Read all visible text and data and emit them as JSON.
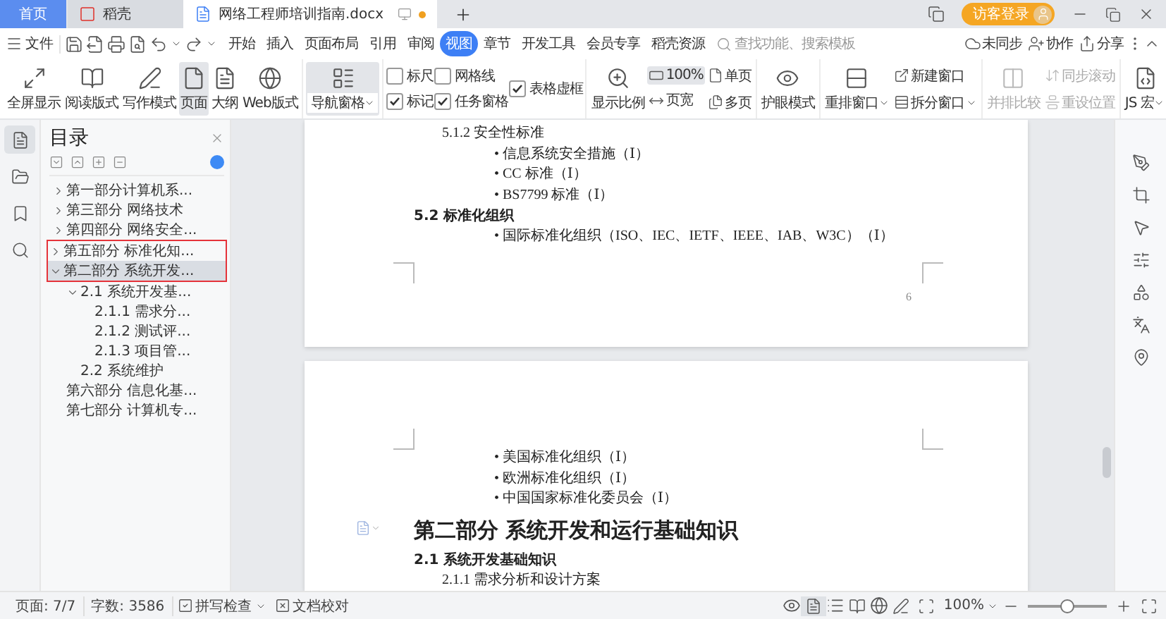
{
  "window": {
    "tabs": [
      {
        "label": "首页",
        "kind": "home",
        "selected": false,
        "modified": false
      },
      {
        "label": "稻壳",
        "kind": "app",
        "selected": false,
        "modified": false
      },
      {
        "label": "网络工程师培训指南.docx",
        "kind": "doc",
        "selected": true,
        "modified": true
      }
    ],
    "login_button": "访客登录"
  },
  "menu": {
    "file": "文件",
    "items": [
      {
        "label": "开始",
        "selected": false
      },
      {
        "label": "插入",
        "selected": false
      },
      {
        "label": "页面布局",
        "selected": false
      },
      {
        "label": "引用",
        "selected": false
      },
      {
        "label": "审阅",
        "selected": false
      },
      {
        "label": "视图",
        "selected": true
      },
      {
        "label": "章节",
        "selected": false
      },
      {
        "label": "开发工具",
        "selected": false
      },
      {
        "label": "会员专享",
        "selected": false
      },
      {
        "label": "稻壳资源",
        "selected": false
      }
    ],
    "search": {
      "placeholder": "查找功能、搜索模板"
    },
    "actions": [
      "未同步",
      "协作",
      "分享"
    ]
  },
  "ribbon": {
    "groups": [
      {
        "columns": [
          [
            {
              "kind": "large",
              "label": "全屏显示",
              "selected": false,
              "disabled": false,
              "dropdown": false
            }
          ],
          [
            {
              "kind": "large",
              "label": "阅读版式",
              "selected": false,
              "disabled": false,
              "dropdown": false
            }
          ],
          [
            {
              "kind": "large",
              "label": "写作模式",
              "selected": false,
              "disabled": false,
              "dropdown": false
            }
          ],
          [
            {
              "kind": "large",
              "label": "页面",
              "selected": true,
              "disabled": false,
              "dropdown": false
            }
          ],
          [
            {
              "kind": "large",
              "label": "大纲",
              "selected": false,
              "disabled": false,
              "dropdown": false
            }
          ],
          [
            {
              "kind": "large",
              "label": "Web版式",
              "selected": false,
              "disabled": false,
              "dropdown": false
            }
          ]
        ]
      },
      {
        "columns": [
          [
            {
              "kind": "large",
              "label": "导航窗格",
              "selected": true,
              "disabled": false,
              "dropdown": true
            }
          ]
        ]
      },
      {
        "columns": [
          [
            {
              "kind": "check",
              "label": "标尺",
              "checked": false
            },
            {
              "kind": "check",
              "label": "标记",
              "checked": true
            }
          ],
          [
            {
              "kind": "check",
              "label": "网格线",
              "checked": false
            },
            {
              "kind": "check",
              "label": "任务窗格",
              "checked": true
            }
          ],
          [
            {
              "kind": "check",
              "label": "表格虚框",
              "checked": true
            }
          ]
        ]
      },
      {
        "columns": [
          [
            {
              "kind": "large",
              "label": "显示比例",
              "selected": false,
              "disabled": false,
              "dropdown": false
            }
          ],
          [
            {
              "kind": "small",
              "label": "100%",
              "selected": true,
              "disabled": false,
              "dropdown": false
            },
            {
              "kind": "small",
              "label": "页宽",
              "selected": false,
              "disabled": false,
              "dropdown": false
            }
          ],
          [
            {
              "kind": "small",
              "label": "单页",
              "selected": false,
              "disabled": false,
              "dropdown": false
            },
            {
              "kind": "small",
              "label": "多页",
              "selected": false,
              "disabled": false,
              "dropdown": false
            }
          ]
        ]
      },
      {
        "columns": [
          [
            {
              "kind": "large",
              "label": "护眼模式",
              "selected": false,
              "disabled": false,
              "dropdown": false
            }
          ]
        ]
      },
      {
        "columns": [
          [
            {
              "kind": "large",
              "label": "重排窗口",
              "selected": false,
              "disabled": false,
              "dropdown": true
            }
          ],
          [
            {
              "kind": "small",
              "label": "新建窗口",
              "selected": false,
              "disabled": false,
              "dropdown": false
            },
            {
              "kind": "small",
              "label": "拆分窗口",
              "selected": false,
              "disabled": false,
              "dropdown": true
            }
          ]
        ]
      },
      {
        "columns": [
          [
            {
              "kind": "large",
              "label": "并排比较",
              "selected": false,
              "disabled": true,
              "dropdown": false
            }
          ],
          [
            {
              "kind": "small",
              "label": "同步滚动",
              "selected": false,
              "disabled": true,
              "dropdown": false
            },
            {
              "kind": "small",
              "label": "重设位置",
              "selected": false,
              "disabled": true,
              "dropdown": false
            }
          ]
        ]
      },
      {
        "columns": [
          [
            {
              "kind": "large",
              "label": "JS 宏",
              "selected": false,
              "disabled": false,
              "dropdown": true
            }
          ]
        ]
      }
    ]
  },
  "side_tabs": [
    {
      "selected": true
    },
    {
      "selected": false
    },
    {
      "selected": false
    },
    {
      "selected": false
    }
  ],
  "nav": {
    "title": "目录",
    "items": [
      {
        "label": "第一部分计算机系...",
        "expanded": false,
        "selected": false,
        "highlighted": false
      },
      {
        "label": "第三部分 网络技术",
        "expanded": false,
        "selected": false,
        "highlighted": false
      },
      {
        "label": "第四部分 网络安全...",
        "expanded": false,
        "selected": false,
        "highlighted": false
      },
      {
        "label": "第五部分 标准化知...",
        "expanded": false,
        "selected": false,
        "highlighted": true
      },
      {
        "label": "第二部分 系统开发...",
        "expanded": true,
        "selected": true,
        "highlighted": true,
        "children": [
          {
            "label": "2.1 系统开发基...",
            "expanded": true,
            "selected": false,
            "children": [
              {
                "label": "2.1.1 需求分...",
                "selected": false
              },
              {
                "label": "2.1.2 测试评...",
                "selected": false
              },
              {
                "label": "2.1.3 项目管...",
                "selected": false
              }
            ]
          },
          {
            "label": "2.2 系统维护",
            "selected": false
          }
        ]
      },
      {
        "label": "第六部分 信息化基...",
        "selected": false,
        "highlighted": false
      },
      {
        "label": "第七部分 计算机专...",
        "selected": false,
        "highlighted": false
      }
    ]
  },
  "document": {
    "pages": [
      {
        "lines": [
          {
            "kind": "heading-3",
            "text": "5.1.2 安全性标准"
          },
          {
            "kind": "bullet",
            "text": "• 信息系统安全措施（Ⅰ）"
          },
          {
            "kind": "bullet",
            "text": "• CC 标准（Ⅰ）"
          },
          {
            "kind": "bullet",
            "text": "• BS7799 标准（Ⅰ）"
          },
          {
            "kind": "heading-2",
            "text": "5.2 标准化组织"
          },
          {
            "kind": "bullet",
            "text": "• 国际标准化组织（ISO、IEC、IETF、IEEE、IAB、W3C）（Ⅰ）"
          }
        ],
        "page_number": "6"
      },
      {
        "lines": [
          {
            "kind": "bullet",
            "text": "• 美国标准化组织（Ⅰ）"
          },
          {
            "kind": "bullet",
            "text": "• 欧洲标准化组织（Ⅰ）"
          },
          {
            "kind": "bullet",
            "text": "• 中国国家标准化委员会（Ⅰ）"
          },
          {
            "kind": "part",
            "text": "第二部分  系统开发和运行基础知识"
          },
          {
            "kind": "heading-2",
            "text": "2.1  系统开发基础知识"
          },
          {
            "kind": "heading-3",
            "text": "2.1.1  需求分析和设计方案"
          }
        ]
      }
    ]
  },
  "status_bar": {
    "page": "页面: 7/7",
    "words": "字数: 3586",
    "spellcheck": "拼写检查",
    "proofread": "文档校对",
    "zoom": "100%",
    "zoom_slider": {
      "level": 0.5
    }
  }
}
